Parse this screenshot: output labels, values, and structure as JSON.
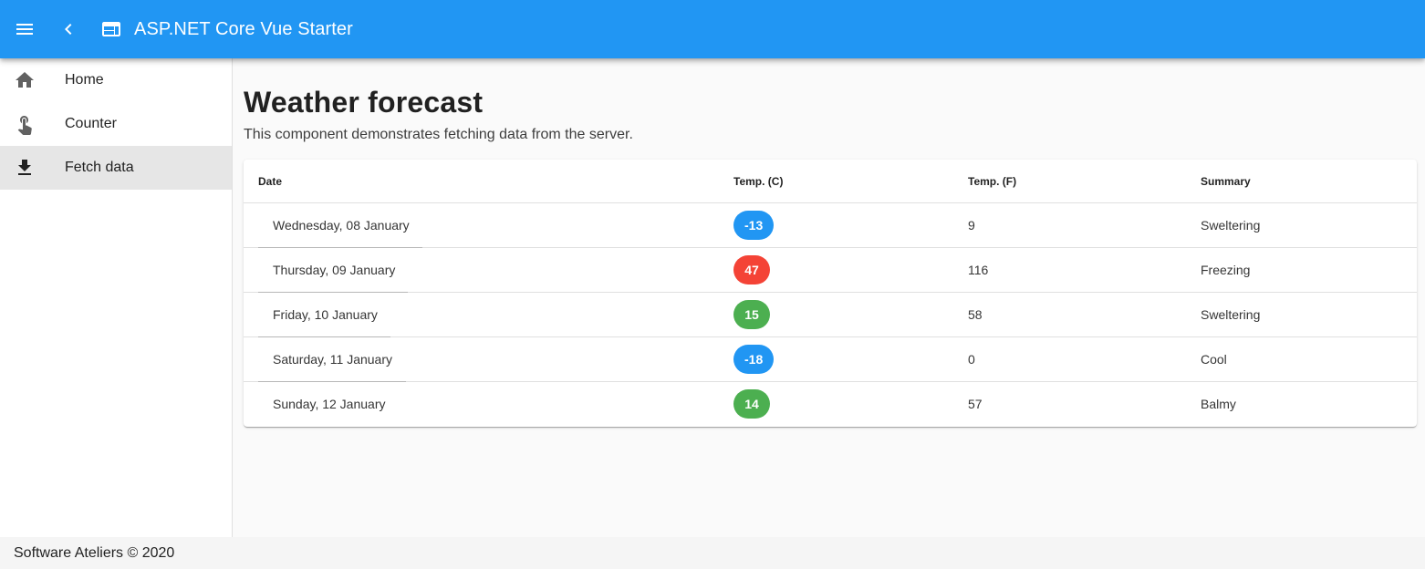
{
  "appbar": {
    "title": "ASP.NET Core Vue Starter",
    "background": "#2196f3"
  },
  "nav": {
    "items": [
      {
        "label": "Home",
        "icon": "home-icon",
        "active": false
      },
      {
        "label": "Counter",
        "icon": "touch-icon",
        "active": false
      },
      {
        "label": "Fetch data",
        "icon": "download-icon",
        "active": true
      }
    ]
  },
  "page": {
    "title": "Weather forecast",
    "subtitle": "This component demonstrates fetching data from the server."
  },
  "table": {
    "headers": [
      "Date",
      "Temp. (C)",
      "Temp. (F)",
      "Summary"
    ],
    "rows": [
      {
        "date": "Wednesday, 08 January",
        "temp_c": "-13",
        "temp_f": "9",
        "summary": "Sweltering",
        "chip_color": "#2196f3"
      },
      {
        "date": "Thursday, 09 January",
        "temp_c": "47",
        "temp_f": "116",
        "summary": "Freezing",
        "chip_color": "#f44336"
      },
      {
        "date": "Friday, 10 January",
        "temp_c": "15",
        "temp_f": "58",
        "summary": "Sweltering",
        "chip_color": "#4caf50"
      },
      {
        "date": "Saturday, 11 January",
        "temp_c": "-18",
        "temp_f": "0",
        "summary": "Cool",
        "chip_color": "#2196f3"
      },
      {
        "date": "Sunday, 12 January",
        "temp_c": "14",
        "temp_f": "57",
        "summary": "Balmy",
        "chip_color": "#4caf50"
      }
    ]
  },
  "footer": {
    "text": "Software Ateliers © 2020"
  }
}
